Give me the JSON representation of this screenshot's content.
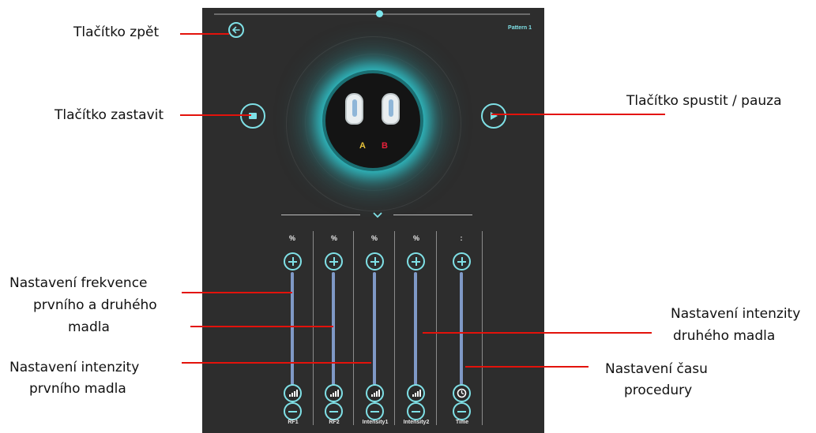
{
  "screen": {
    "pattern_label": "Pattern 1",
    "handle_a_label": "A",
    "handle_b_label": "B",
    "handle_a_color": "#e8c33a",
    "handle_b_color": "#e8203a",
    "accent_color": "#7fe0e6"
  },
  "sliders": [
    {
      "unit": "%",
      "label": "RF1",
      "icon": "signal-bars-icon"
    },
    {
      "unit": "%",
      "label": "RF2",
      "icon": "signal-bars-icon"
    },
    {
      "unit": "%",
      "label": "Intensity1",
      "icon": "signal-bars-icon"
    },
    {
      "unit": "%",
      "label": "Intensity2",
      "icon": "signal-bars-icon"
    },
    {
      "unit": ":",
      "label": "Time",
      "icon": "clock-icon"
    }
  ],
  "annotations": {
    "back": "Tlačítko zpět",
    "stop": "Tlačítko zastavit",
    "play_pause": "Tlačítko spustit / pauza",
    "freq_line1": "Nastavení frekvence",
    "freq_line2": "prvního a druhého",
    "freq_line3": "madla",
    "int1_line1": "Nastavení intenzity",
    "int1_line2": "prvního madla",
    "int2_line1": "Nastavení intenzity",
    "int2_line2": "druhého madla",
    "time_line1": "Nastavení času",
    "time_line2": "procedury"
  },
  "icons": {
    "back": "back-arrow-icon",
    "stop": "stop-icon",
    "play": "play-icon",
    "expand": "chevron-down-icon"
  }
}
